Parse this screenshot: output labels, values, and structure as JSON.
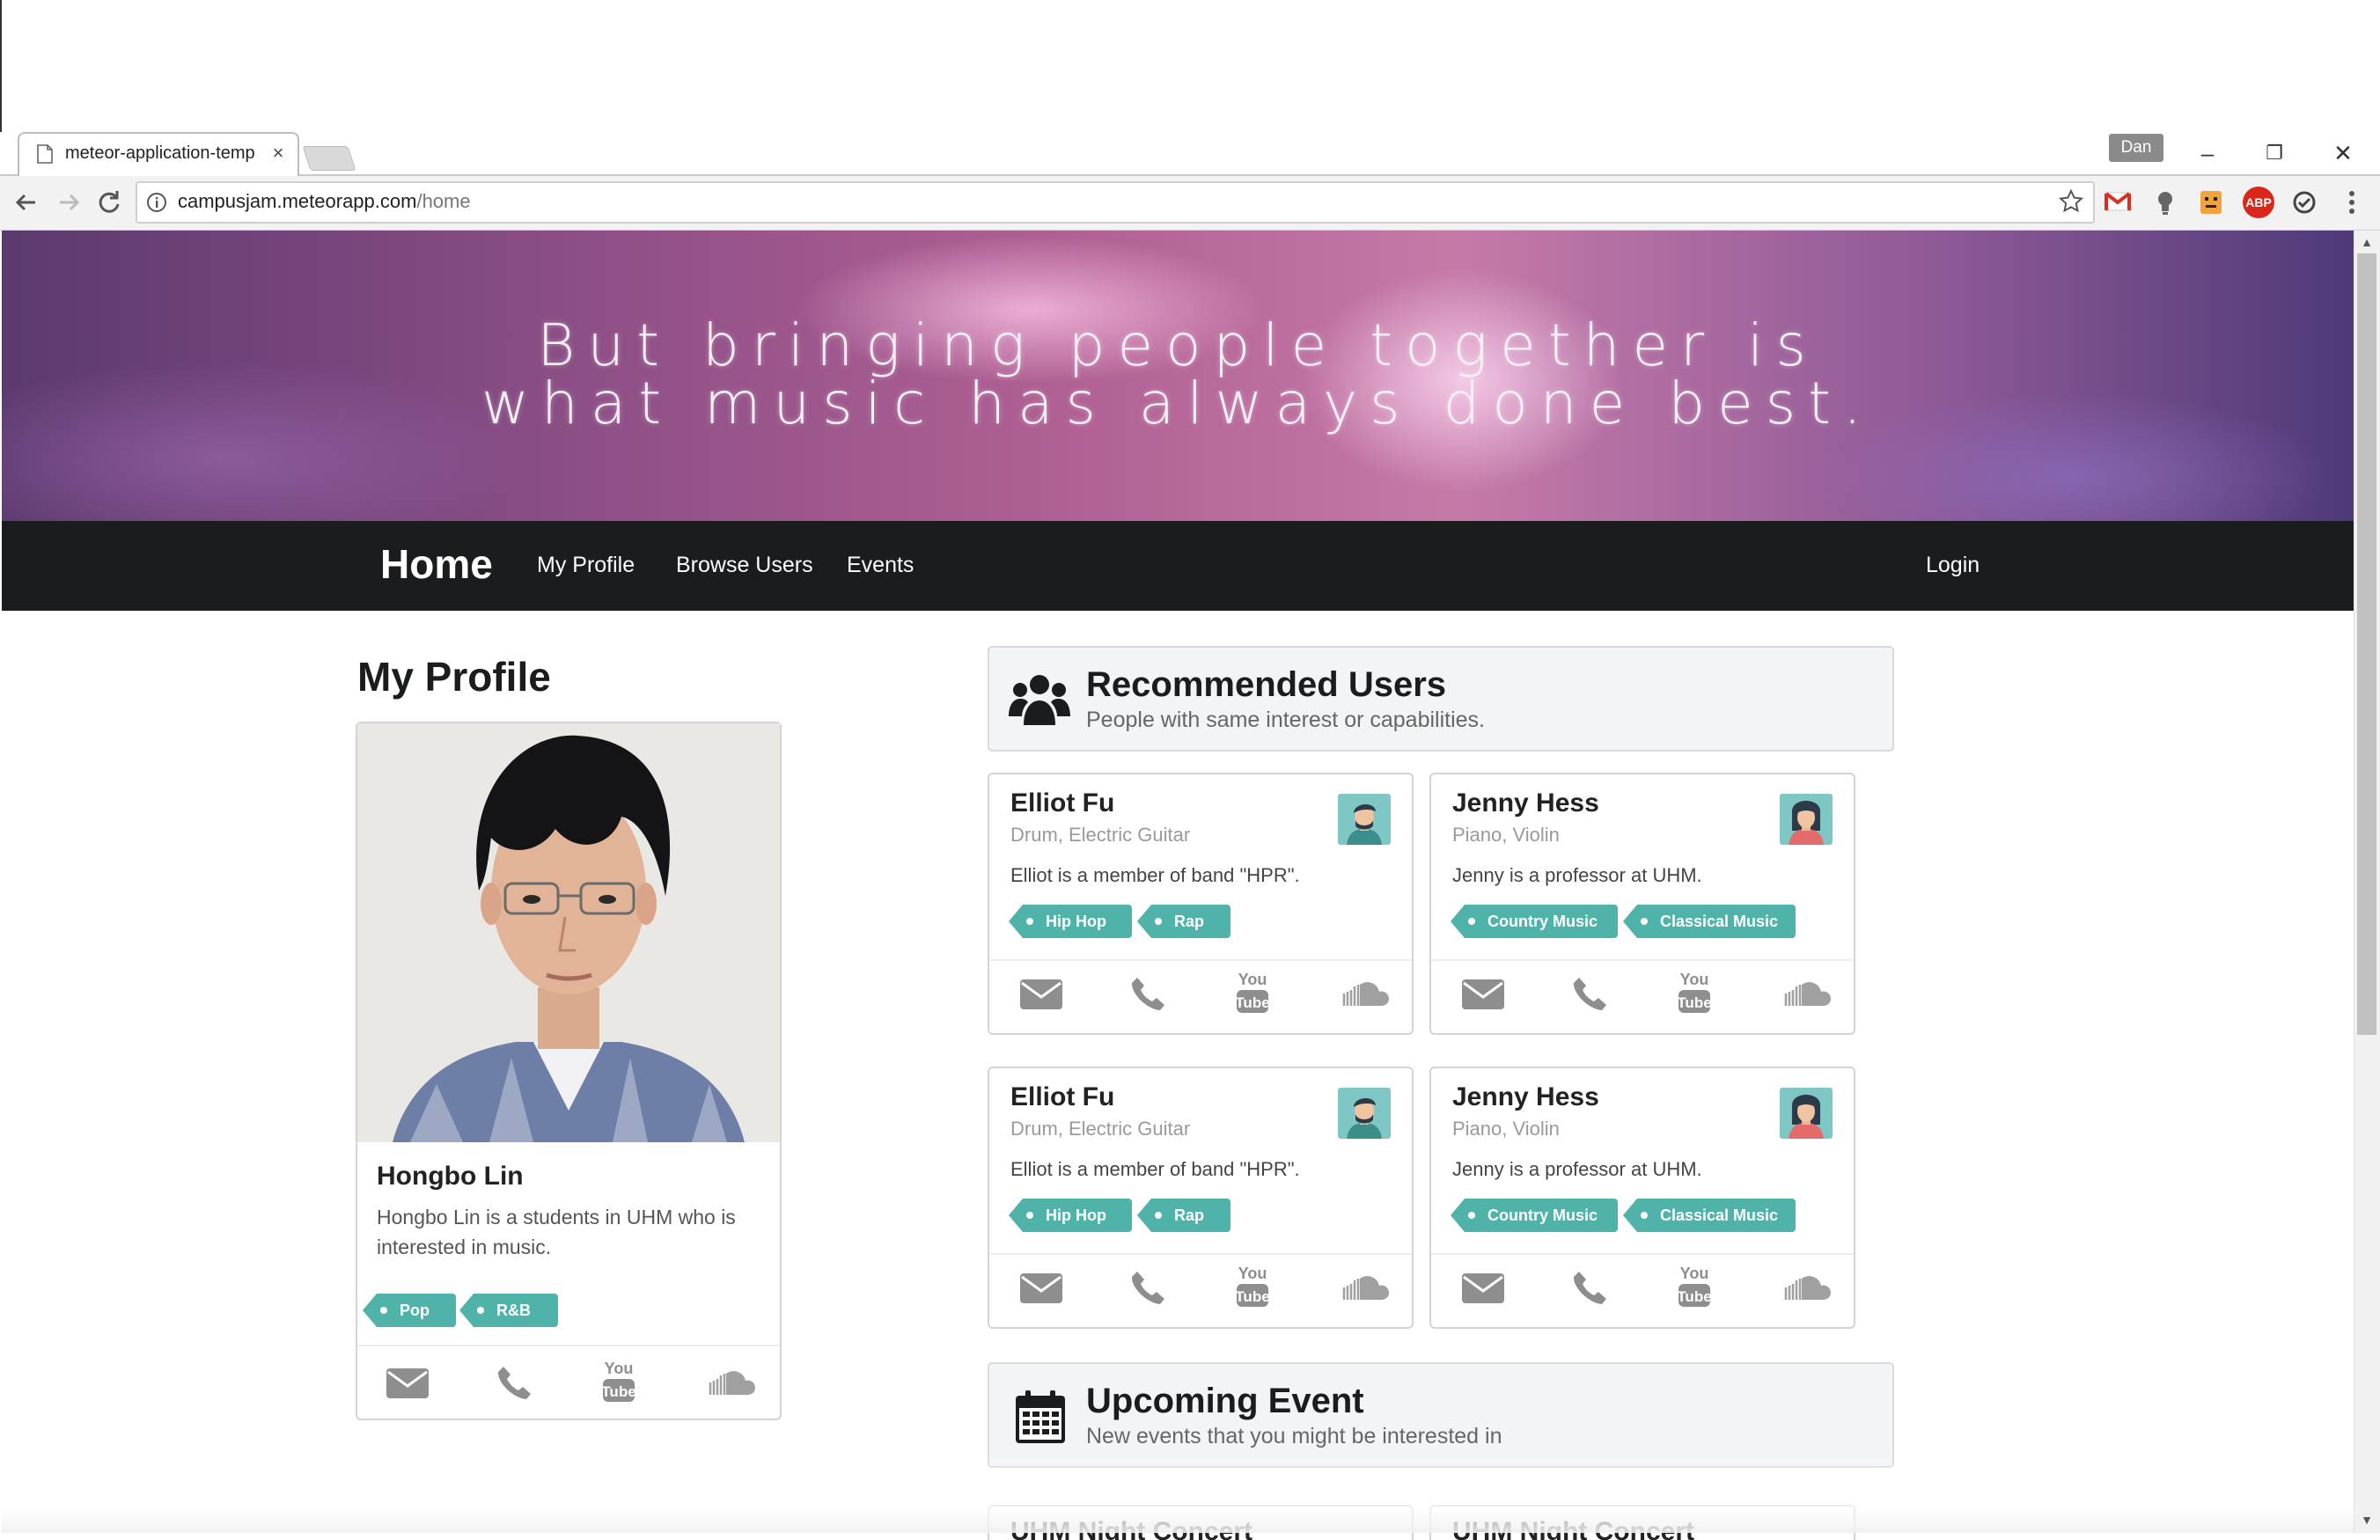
{
  "browser": {
    "tab_title": "meteor-application-temp",
    "tab_close": "×",
    "profile": "Dan",
    "url_host": "campusjam.meteorapp.com",
    "url_path": "/home",
    "window_controls": {
      "minimize": "–",
      "restore": "❐",
      "close": "✕"
    },
    "extensions": [
      "gmail-icon",
      "lightbulb-icon",
      "honey-icon",
      "adblock-plus-icon",
      "sync-icon"
    ],
    "adblock_label": "ABP"
  },
  "banner": {
    "line1": "But bringing people together is",
    "line2": "what music has always done best."
  },
  "nav": {
    "brand": "Home",
    "links": [
      "My Profile",
      "Browse Users",
      "Events"
    ],
    "login": "Login"
  },
  "my_profile": {
    "heading": "My Profile",
    "name": "Hongbo Lin",
    "description": "Hongbo Lin is a students in UHM who is interested in music.",
    "tags": [
      "Pop",
      "R&B"
    ]
  },
  "recommended": {
    "title": "Recommended Users",
    "subtitle": "People with same interest or capabilities.",
    "users": [
      {
        "name": "Elliot Fu",
        "instruments": "Drum, Electric Guitar",
        "description": "Elliot is a member of band \"HPR\".",
        "tags": [
          "Hip Hop",
          "Rap"
        ],
        "avatar": "male-avatar-icon"
      },
      {
        "name": "Jenny Hess",
        "instruments": "Piano, Violin",
        "description": "Jenny is a professor at UHM.",
        "tags": [
          "Country Music",
          "Classical Music"
        ],
        "avatar": "female-avatar-icon"
      },
      {
        "name": "Elliot Fu",
        "instruments": "Drum, Electric Guitar",
        "description": "Elliot is a member of band \"HPR\".",
        "tags": [
          "Hip Hop",
          "Rap"
        ],
        "avatar": "male-avatar-icon"
      },
      {
        "name": "Jenny Hess",
        "instruments": "Piano, Violin",
        "description": "Jenny is a professor at UHM.",
        "tags": [
          "Country Music",
          "Classical Music"
        ],
        "avatar": "female-avatar-icon"
      }
    ]
  },
  "contact_icons": [
    "mail-icon",
    "phone-icon",
    "youtube-icon",
    "soundcloud-icon"
  ],
  "youtube_text": {
    "top": "You",
    "bottom": "Tube"
  },
  "upcoming": {
    "title": "Upcoming Event",
    "subtitle": "New events that you might be interested in",
    "events": [
      "UHM Night Concert",
      "UHM Night Concert"
    ]
  },
  "colors": {
    "tag": "#50b3a9",
    "navbar": "#1b1c1d",
    "banner": "#b06093"
  }
}
